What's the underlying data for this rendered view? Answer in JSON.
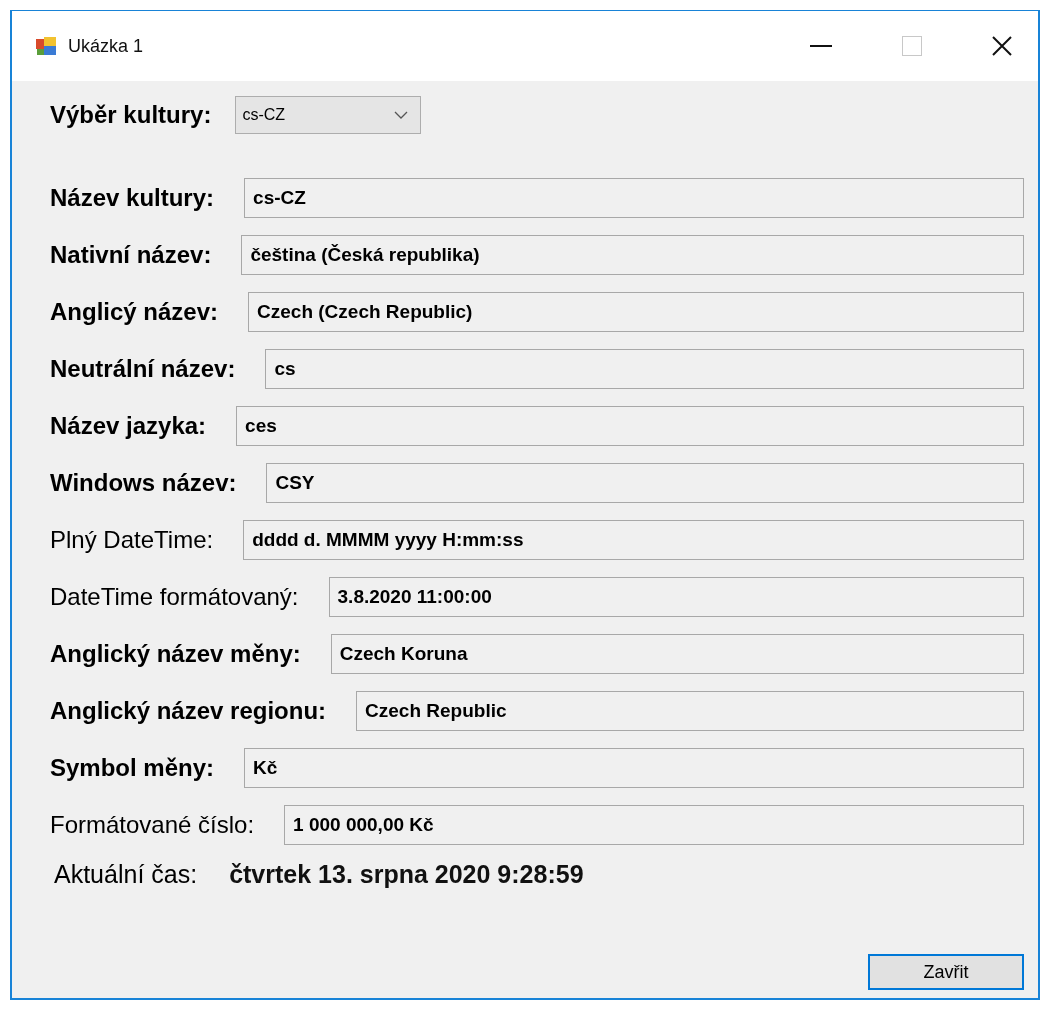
{
  "window": {
    "title": "Ukázka 1",
    "maximize_disabled": true
  },
  "culture_picker": {
    "label": "Výběr kultury:",
    "value": "cs-CZ"
  },
  "fields": [
    {
      "label": "Název kultury:",
      "value": "cs-CZ",
      "bold": true
    },
    {
      "label": "Nativní název:",
      "value": "čeština (Česká republika)",
      "bold": true
    },
    {
      "label": "Anglicý název:",
      "value": "Czech (Czech Republic)",
      "bold": true
    },
    {
      "label": "Neutrální název:",
      "value": "cs",
      "bold": true
    },
    {
      "label": "Název jazyka:",
      "value": "ces",
      "bold": true
    },
    {
      "label": "Windows název:",
      "value": "CSY",
      "bold": true
    },
    {
      "label": "Plný DateTime:",
      "value": "dddd d. MMMM yyyy H:mm:ss",
      "bold": false
    },
    {
      "label": "DateTime formátovaný:",
      "value": "3.8.2020 11:00:00",
      "bold": false
    },
    {
      "label": "Anglický název měny:",
      "value": "Czech Koruna",
      "bold": true
    },
    {
      "label": "Anglický název regionu:",
      "value": "Czech Republic",
      "bold": true
    },
    {
      "label": "Symbol měny:",
      "value": "Kč",
      "bold": true
    },
    {
      "label": "Formátované číslo:",
      "value": "1 000 000,00 Kč",
      "bold": false
    }
  ],
  "current_time": {
    "label": "Aktuální čas:",
    "value": "čtvrtek 13. srpna 2020 9:28:59"
  },
  "buttons": [
    {
      "label": "Zavřit"
    }
  ]
}
